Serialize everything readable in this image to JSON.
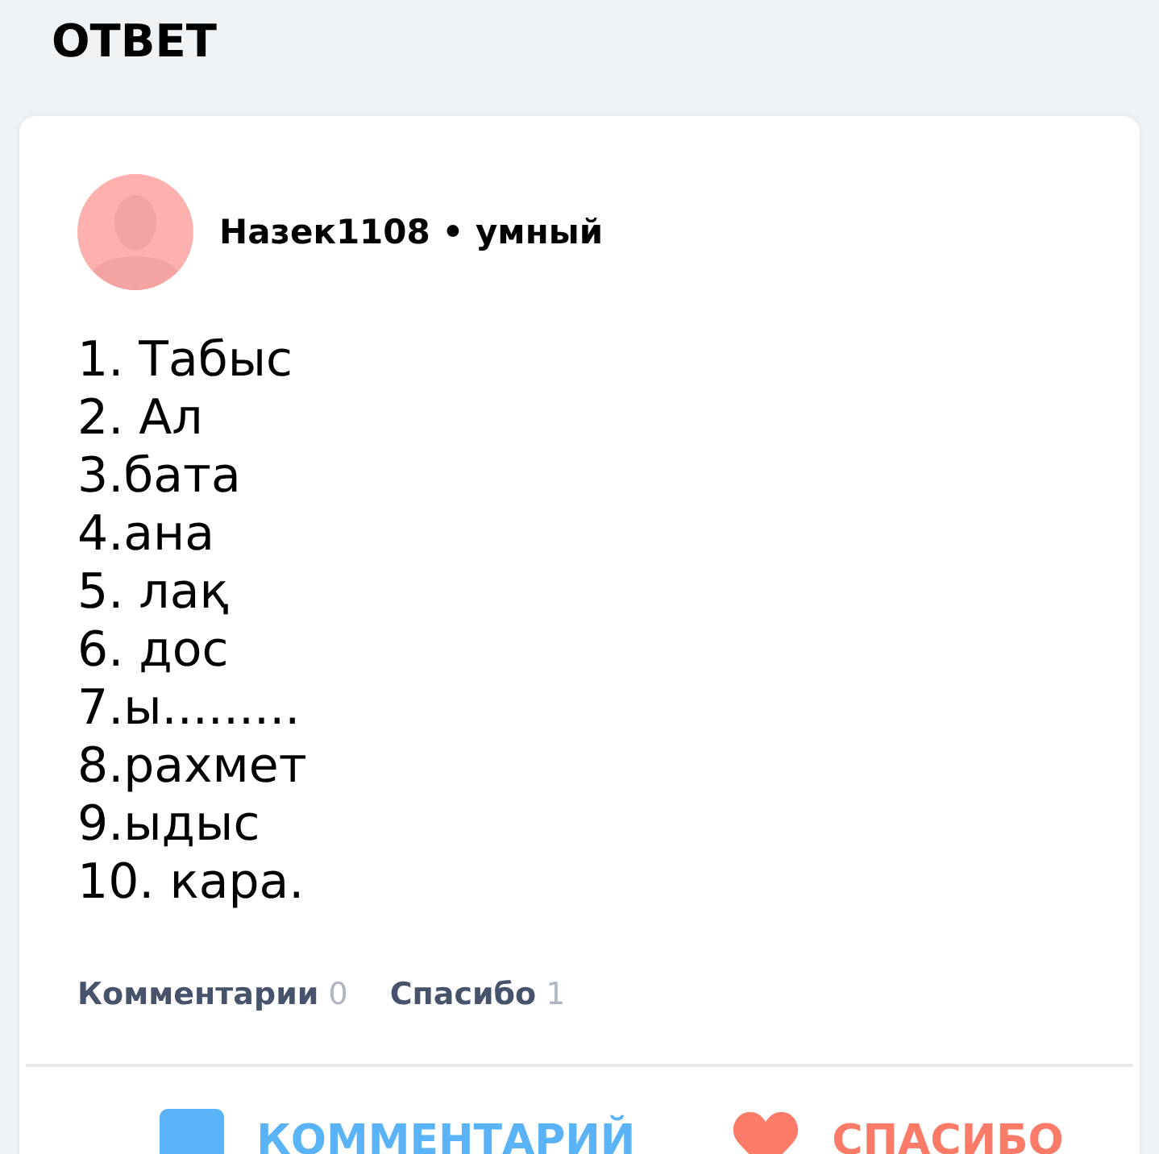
{
  "heading": "ОТВЕТ",
  "author": {
    "name": "Назек1108",
    "separator": "•",
    "rank": "умный"
  },
  "answer_lines": [
    "1. Табыс",
    "2. Ал",
    "3.бата",
    "4.ана",
    "5. лақ",
    "6. дос",
    "7.ы.........",
    "8.рахмет",
    "9.ыдыс",
    "10. кара."
  ],
  "stats": [
    {
      "label": "Комментарии",
      "count": "0"
    },
    {
      "label": "Спасибо",
      "count": "1"
    }
  ],
  "actions": [
    {
      "kind": "comment",
      "label": "КОММЕНТАРИЙ"
    },
    {
      "kind": "thanks",
      "label": "СПАСИБО"
    }
  ]
}
